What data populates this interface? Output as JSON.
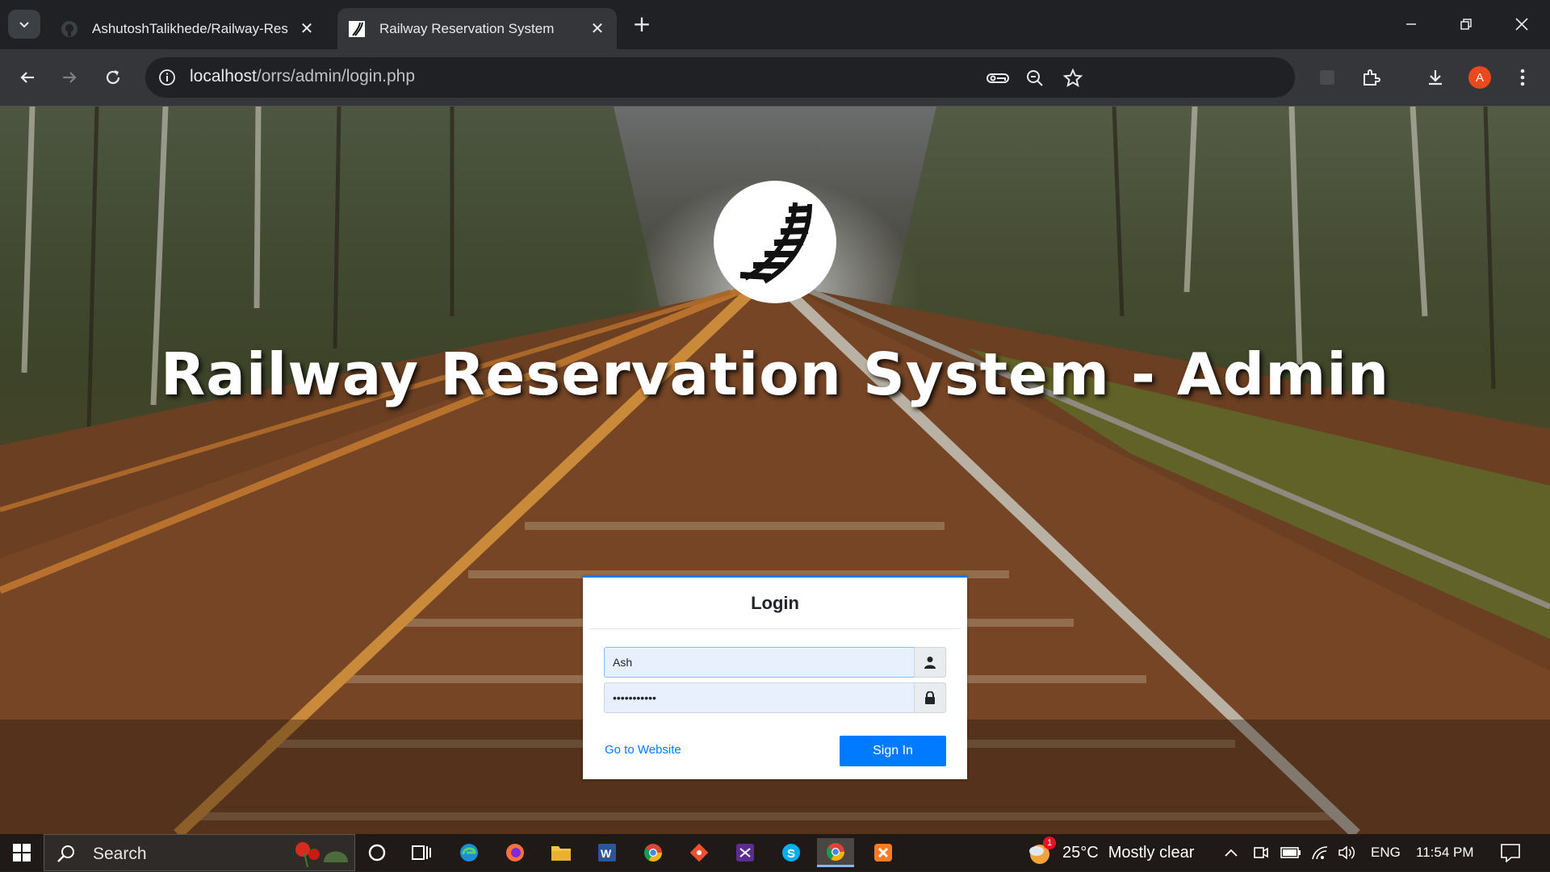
{
  "browser": {
    "tabs": [
      {
        "title": "AshutoshTalikhede/Railway-Res",
        "active": false,
        "icon": "github-icon"
      },
      {
        "title": "Railway Reservation System",
        "active": true,
        "icon": "railway-favicon"
      }
    ],
    "address": {
      "host": "localhost",
      "path": "/orrs/admin/login.php"
    },
    "profile_initial": "A",
    "colors": {
      "tabstrip": "#202124",
      "toolbar": "#35363a",
      "profile": "#e8491d"
    }
  },
  "page": {
    "hero_title": "Railway Reservation System - Admin",
    "login": {
      "heading": "Login",
      "username_value": "Ash",
      "password_value": "•••••••••••",
      "link_text": "Go to Website",
      "submit_label": "Sign In"
    },
    "colors": {
      "accent": "#007bff",
      "card": "#ffffff",
      "input_autofill": "#e8f0fe"
    }
  },
  "taskbar": {
    "search_label": "Search",
    "weather": {
      "temp": "25°C",
      "condition": "Mostly clear",
      "badge": "1"
    },
    "language": "ENG",
    "time": "11:54 PM",
    "apps": [
      "cortana-icon",
      "task-view-icon",
      "edge-icon",
      "firefox-icon",
      "file-explorer-icon",
      "word-icon",
      "chrome-icon",
      "git-icon",
      "visual-studio-icon",
      "skype-icon",
      "chrome-active-icon",
      "xampp-icon"
    ]
  }
}
